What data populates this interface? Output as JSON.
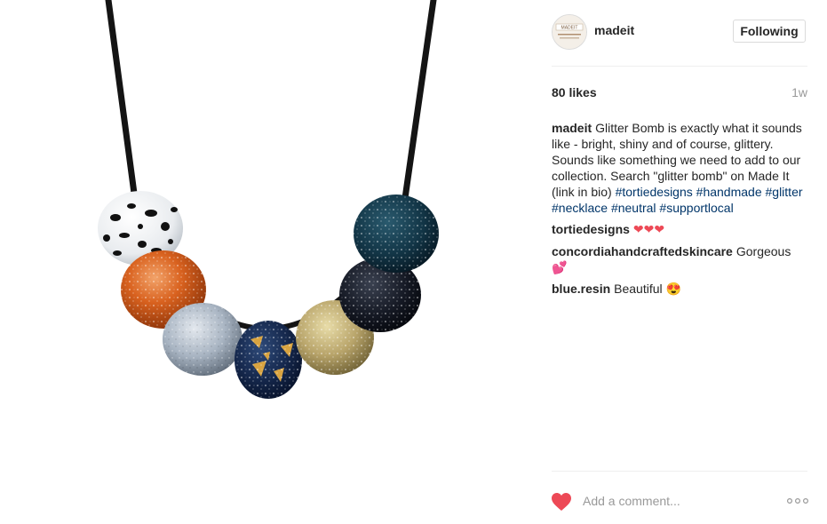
{
  "post": {
    "image_alt": "Glitter bead necklace on black cord"
  },
  "header": {
    "avatar_text": "MADEIT",
    "username": "madeit",
    "follow_label": "Following"
  },
  "stats": {
    "likes": "80 likes",
    "time_ago": "1w"
  },
  "caption": {
    "user": "madeit",
    "text": "Glitter Bomb is exactly what it sounds like - bright, shiny and of course, glittery. Sounds like something we need to add to our collection. Search \"glitter bomb\" on Made It (link in bio)",
    "hashtags": [
      "#tortiedesigns",
      "#handmade",
      "#glitter",
      "#necklace",
      "#neutral",
      "#supportlocal"
    ]
  },
  "comments": [
    {
      "user": "tortiedesigns",
      "text": "❤❤❤"
    },
    {
      "user": "concordiahandcraftedskincare",
      "text": "Gorgeous 💕"
    },
    {
      "user": "blue.resin",
      "text": "Beautiful 😍"
    }
  ],
  "footer": {
    "comment_placeholder": "Add a comment...",
    "like_icon": "heart-icon",
    "more_icon": "more-options-icon"
  },
  "colors": {
    "like_red": "#ed4956",
    "hashtag_blue": "#003569",
    "muted_gray": "#999999"
  }
}
